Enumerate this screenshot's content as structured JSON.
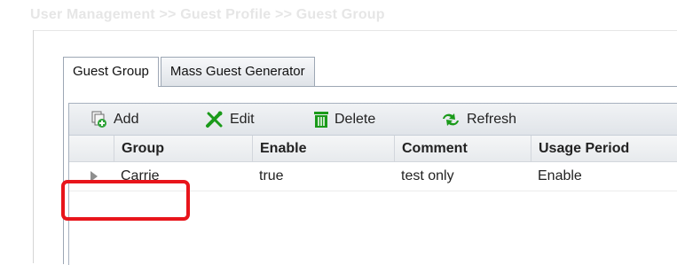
{
  "breadcrumb": "User Management >> Guest Profile >> Guest Group",
  "tabs": [
    {
      "label": "Guest Group",
      "active": true
    },
    {
      "label": "Mass Guest Generator",
      "active": false
    }
  ],
  "toolbar": {
    "add_label": "Add",
    "edit_label": "Edit",
    "delete_label": "Delete",
    "refresh_label": "Refresh",
    "icons": [
      "add-icon",
      "edit-icon",
      "delete-icon",
      "refresh-icon"
    ]
  },
  "table": {
    "columns": [
      "Group",
      "Enable",
      "Comment",
      "Usage Period"
    ],
    "rows": [
      {
        "group": "Carrie",
        "enable": "true",
        "comment": "test only",
        "usage_period": "Enable"
      }
    ]
  },
  "highlight_color": "#e8151b"
}
